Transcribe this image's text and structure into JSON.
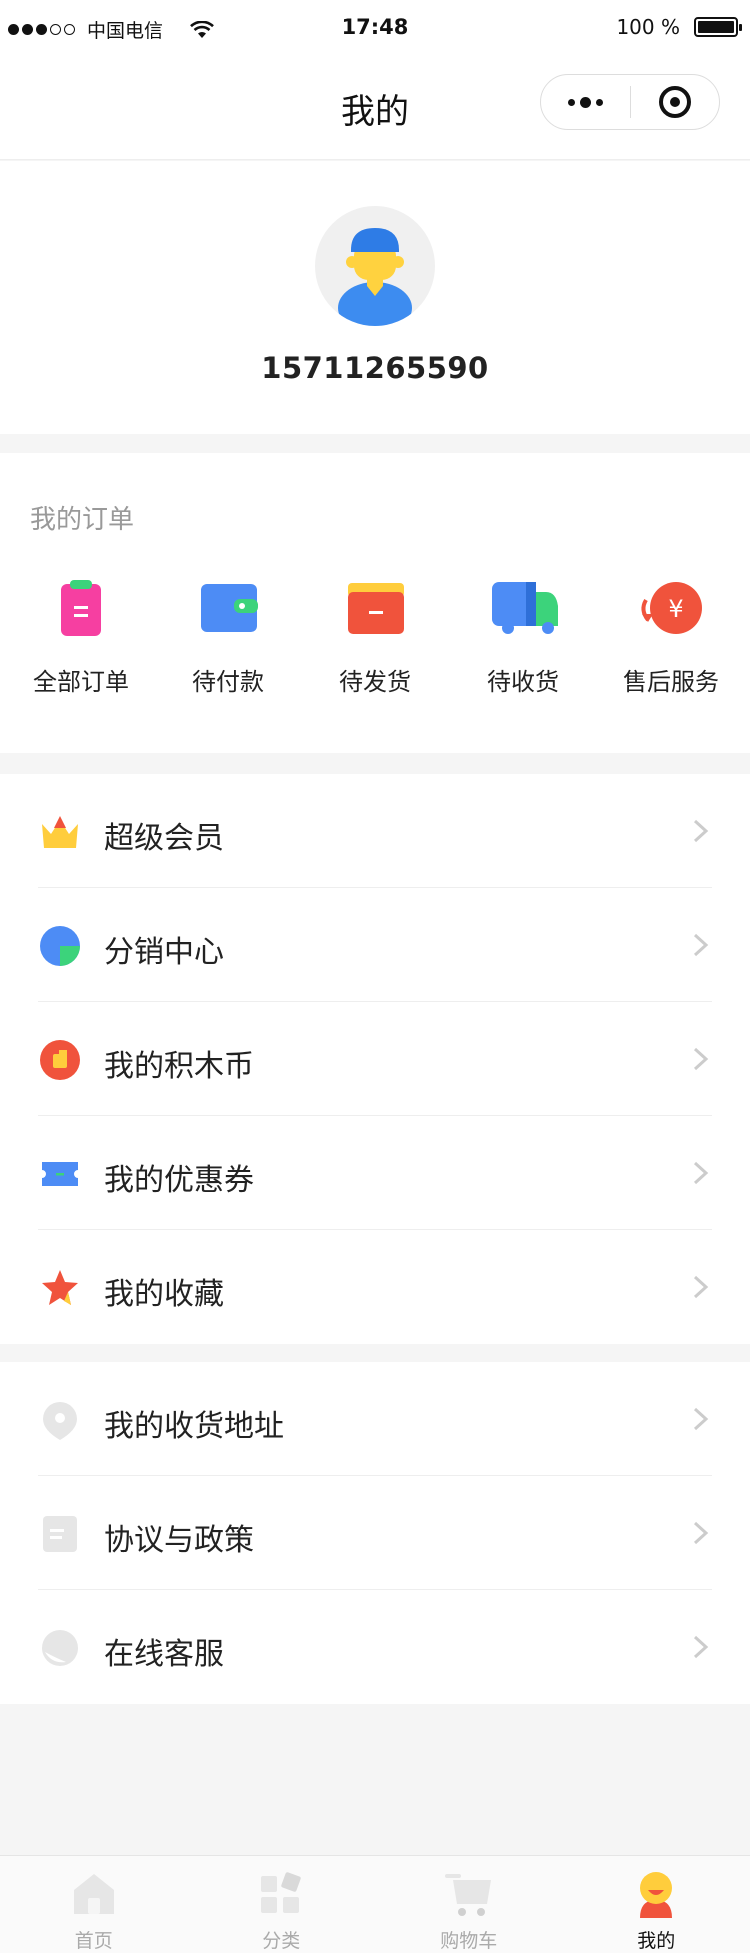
{
  "status_bar": {
    "carrier": "中国电信",
    "time": "17:48",
    "battery": "100 %"
  },
  "nav": {
    "title": "我的"
  },
  "profile": {
    "phone": "15711265590"
  },
  "orders": {
    "title": "我的订单",
    "items": [
      {
        "label": "全部订单",
        "icon": "clipboard-icon"
      },
      {
        "label": "待付款",
        "icon": "wallet-icon"
      },
      {
        "label": "待发货",
        "icon": "box-icon"
      },
      {
        "label": "待收货",
        "icon": "truck-icon"
      },
      {
        "label": "售后服务",
        "icon": "yen-refund-icon"
      }
    ]
  },
  "menu_group_1": [
    {
      "label": "超级会员",
      "icon": "crown-icon"
    },
    {
      "label": "分销中心",
      "icon": "pie-chart-icon"
    },
    {
      "label": "我的积木币",
      "icon": "coin-icon"
    },
    {
      "label": "我的优惠券",
      "icon": "coupon-icon"
    },
    {
      "label": "我的收藏",
      "icon": "star-icon"
    }
  ],
  "menu_group_2": [
    {
      "label": "我的收货地址",
      "icon": "location-pin-icon"
    },
    {
      "label": "协议与政策",
      "icon": "document-icon"
    },
    {
      "label": "在线客服",
      "icon": "chat-bubble-icon"
    }
  ],
  "tab_bar": [
    {
      "label": "首页",
      "icon": "home-icon",
      "active": false
    },
    {
      "label": "分类",
      "icon": "category-icon",
      "active": false
    },
    {
      "label": "购物车",
      "icon": "cart-icon",
      "active": false
    },
    {
      "label": "我的",
      "icon": "user-icon",
      "active": true
    }
  ],
  "colors": {
    "accent_red": "#f0533c",
    "brand_yellow": "#ffcd3c",
    "blue": "#4d8cf5",
    "green": "#3cd37b",
    "pink": "#f63fa1"
  }
}
